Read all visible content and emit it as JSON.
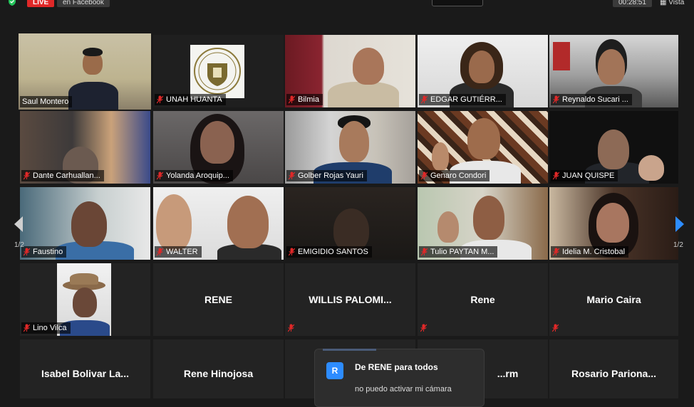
{
  "top_bar": {
    "live_label": "LIVE",
    "live_target": "en Facebook",
    "clock": "00:28:51",
    "view_label": "Vista"
  },
  "participants": [
    {
      "name": "Saul Montero",
      "video": true,
      "active": true
    },
    {
      "name": "UNAH HUANTA",
      "video": true
    },
    {
      "name": "Bilmia",
      "video": true
    },
    {
      "name": "EDGAR GUTIÉRR...",
      "video": true
    },
    {
      "name": "Reynaldo Sucari ...",
      "video": true
    },
    {
      "name": "Dante Carhuallan...",
      "video": true
    },
    {
      "name": "Yolanda Aroquip...",
      "video": true
    },
    {
      "name": "Golber Rojas Yauri",
      "video": true
    },
    {
      "name": "Genaro Condori",
      "video": true
    },
    {
      "name": "JUAN QUISPE",
      "video": true
    },
    {
      "name": "Faustino",
      "video": true
    },
    {
      "name": "WALTER",
      "video": true
    },
    {
      "name": "EMIGIDIO SANTOS",
      "video": true
    },
    {
      "name": "Tulio PAYTAN M...",
      "video": true
    },
    {
      "name": "Idelia M. Cristobal",
      "video": true
    },
    {
      "name": "Lino Vilca",
      "video": true
    },
    {
      "name": "RENE",
      "video": false
    },
    {
      "name": "WILLIS PALOMI...",
      "video": false
    },
    {
      "name": "Rene",
      "video": false
    },
    {
      "name": "Mario Caira",
      "video": false
    },
    {
      "name": "Isabel Bolivar La...",
      "video": false
    },
    {
      "name": "Rene Hinojosa",
      "video": false
    },
    {
      "name": "",
      "video": false
    },
    {
      "name": "...rm",
      "video": false
    },
    {
      "name": "Rosario Pariona...",
      "video": false
    }
  ],
  "pagination": {
    "left": "1/2",
    "right": "1/2"
  },
  "chat": {
    "avatar_letter": "R",
    "from": "De RENE para todos",
    "message": "no puedo activar mi cámara"
  },
  "colors": {
    "background": "#1a1a1a",
    "tile": "#232323",
    "active_speaker": "#c8e052",
    "live": "#e02828",
    "muted_mic": "#e02828",
    "nav_arrow": "#2d8cff"
  }
}
